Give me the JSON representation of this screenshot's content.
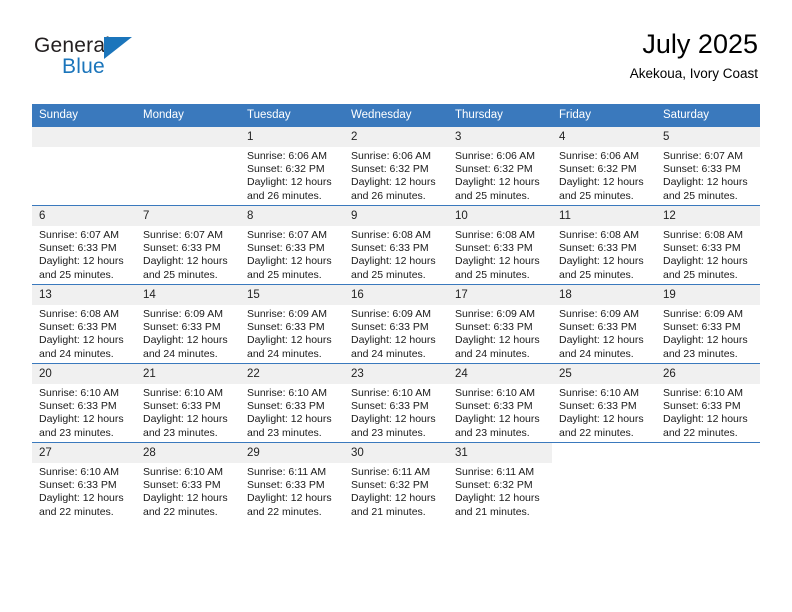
{
  "brand": {
    "name_part1": "General",
    "name_part2": "Blue",
    "flag_icon": "triangle-flag-icon",
    "accent_color": "#1b75bb"
  },
  "header": {
    "title": "July 2025",
    "subtitle": "Akekoua, Ivory Coast"
  },
  "colors": {
    "header_row": "#3a79bd",
    "daynum_band": "#f0f0f0",
    "text": "#000000"
  },
  "weekdays": [
    "Sunday",
    "Monday",
    "Tuesday",
    "Wednesday",
    "Thursday",
    "Friday",
    "Saturday"
  ],
  "weeks": [
    [
      {
        "day": "",
        "empty": true,
        "blank": false,
        "lines": []
      },
      {
        "day": "",
        "empty": true,
        "blank": false,
        "lines": []
      },
      {
        "day": "1",
        "lines": [
          "Sunrise: 6:06 AM",
          "Sunset: 6:32 PM",
          "Daylight: 12 hours",
          "and 26 minutes."
        ]
      },
      {
        "day": "2",
        "lines": [
          "Sunrise: 6:06 AM",
          "Sunset: 6:32 PM",
          "Daylight: 12 hours",
          "and 26 minutes."
        ]
      },
      {
        "day": "3",
        "lines": [
          "Sunrise: 6:06 AM",
          "Sunset: 6:32 PM",
          "Daylight: 12 hours",
          "and 25 minutes."
        ]
      },
      {
        "day": "4",
        "lines": [
          "Sunrise: 6:06 AM",
          "Sunset: 6:32 PM",
          "Daylight: 12 hours",
          "and 25 minutes."
        ]
      },
      {
        "day": "5",
        "lines": [
          "Sunrise: 6:07 AM",
          "Sunset: 6:33 PM",
          "Daylight: 12 hours",
          "and 25 minutes."
        ]
      }
    ],
    [
      {
        "day": "6",
        "lines": [
          "Sunrise: 6:07 AM",
          "Sunset: 6:33 PM",
          "Daylight: 12 hours",
          "and 25 minutes."
        ]
      },
      {
        "day": "7",
        "lines": [
          "Sunrise: 6:07 AM",
          "Sunset: 6:33 PM",
          "Daylight: 12 hours",
          "and 25 minutes."
        ]
      },
      {
        "day": "8",
        "lines": [
          "Sunrise: 6:07 AM",
          "Sunset: 6:33 PM",
          "Daylight: 12 hours",
          "and 25 minutes."
        ]
      },
      {
        "day": "9",
        "lines": [
          "Sunrise: 6:08 AM",
          "Sunset: 6:33 PM",
          "Daylight: 12 hours",
          "and 25 minutes."
        ]
      },
      {
        "day": "10",
        "lines": [
          "Sunrise: 6:08 AM",
          "Sunset: 6:33 PM",
          "Daylight: 12 hours",
          "and 25 minutes."
        ]
      },
      {
        "day": "11",
        "lines": [
          "Sunrise: 6:08 AM",
          "Sunset: 6:33 PM",
          "Daylight: 12 hours",
          "and 25 minutes."
        ]
      },
      {
        "day": "12",
        "lines": [
          "Sunrise: 6:08 AM",
          "Sunset: 6:33 PM",
          "Daylight: 12 hours",
          "and 25 minutes."
        ]
      }
    ],
    [
      {
        "day": "13",
        "lines": [
          "Sunrise: 6:08 AM",
          "Sunset: 6:33 PM",
          "Daylight: 12 hours",
          "and 24 minutes."
        ]
      },
      {
        "day": "14",
        "lines": [
          "Sunrise: 6:09 AM",
          "Sunset: 6:33 PM",
          "Daylight: 12 hours",
          "and 24 minutes."
        ]
      },
      {
        "day": "15",
        "lines": [
          "Sunrise: 6:09 AM",
          "Sunset: 6:33 PM",
          "Daylight: 12 hours",
          "and 24 minutes."
        ]
      },
      {
        "day": "16",
        "lines": [
          "Sunrise: 6:09 AM",
          "Sunset: 6:33 PM",
          "Daylight: 12 hours",
          "and 24 minutes."
        ]
      },
      {
        "day": "17",
        "lines": [
          "Sunrise: 6:09 AM",
          "Sunset: 6:33 PM",
          "Daylight: 12 hours",
          "and 24 minutes."
        ]
      },
      {
        "day": "18",
        "lines": [
          "Sunrise: 6:09 AM",
          "Sunset: 6:33 PM",
          "Daylight: 12 hours",
          "and 24 minutes."
        ]
      },
      {
        "day": "19",
        "lines": [
          "Sunrise: 6:09 AM",
          "Sunset: 6:33 PM",
          "Daylight: 12 hours",
          "and 23 minutes."
        ]
      }
    ],
    [
      {
        "day": "20",
        "lines": [
          "Sunrise: 6:10 AM",
          "Sunset: 6:33 PM",
          "Daylight: 12 hours",
          "and 23 minutes."
        ]
      },
      {
        "day": "21",
        "lines": [
          "Sunrise: 6:10 AM",
          "Sunset: 6:33 PM",
          "Daylight: 12 hours",
          "and 23 minutes."
        ]
      },
      {
        "day": "22",
        "lines": [
          "Sunrise: 6:10 AM",
          "Sunset: 6:33 PM",
          "Daylight: 12 hours",
          "and 23 minutes."
        ]
      },
      {
        "day": "23",
        "lines": [
          "Sunrise: 6:10 AM",
          "Sunset: 6:33 PM",
          "Daylight: 12 hours",
          "and 23 minutes."
        ]
      },
      {
        "day": "24",
        "lines": [
          "Sunrise: 6:10 AM",
          "Sunset: 6:33 PM",
          "Daylight: 12 hours",
          "and 23 minutes."
        ]
      },
      {
        "day": "25",
        "lines": [
          "Sunrise: 6:10 AM",
          "Sunset: 6:33 PM",
          "Daylight: 12 hours",
          "and 22 minutes."
        ]
      },
      {
        "day": "26",
        "lines": [
          "Sunrise: 6:10 AM",
          "Sunset: 6:33 PM",
          "Daylight: 12 hours",
          "and 22 minutes."
        ]
      }
    ],
    [
      {
        "day": "27",
        "lines": [
          "Sunrise: 6:10 AM",
          "Sunset: 6:33 PM",
          "Daylight: 12 hours",
          "and 22 minutes."
        ]
      },
      {
        "day": "28",
        "lines": [
          "Sunrise: 6:10 AM",
          "Sunset: 6:33 PM",
          "Daylight: 12 hours",
          "and 22 minutes."
        ]
      },
      {
        "day": "29",
        "lines": [
          "Sunrise: 6:11 AM",
          "Sunset: 6:33 PM",
          "Daylight: 12 hours",
          "and 22 minutes."
        ]
      },
      {
        "day": "30",
        "lines": [
          "Sunrise: 6:11 AM",
          "Sunset: 6:32 PM",
          "Daylight: 12 hours",
          "and 21 minutes."
        ]
      },
      {
        "day": "31",
        "lines": [
          "Sunrise: 6:11 AM",
          "Sunset: 6:32 PM",
          "Daylight: 12 hours",
          "and 21 minutes."
        ]
      },
      {
        "day": "",
        "empty": false,
        "blank": true,
        "lines": []
      },
      {
        "day": "",
        "empty": false,
        "blank": true,
        "lines": []
      }
    ]
  ]
}
